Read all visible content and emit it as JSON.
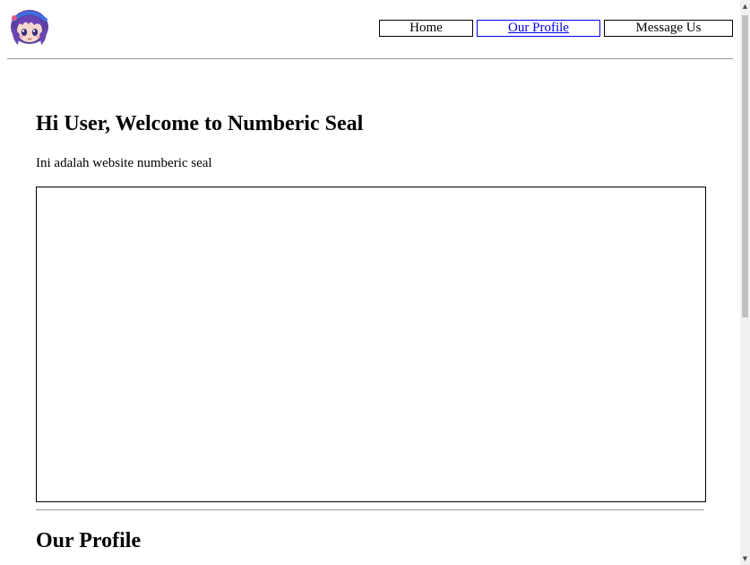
{
  "header": {
    "logo_icon": "anime-girl-avatar-icon",
    "nav": [
      {
        "label": "Home",
        "active": false
      },
      {
        "label": "Our Profile",
        "active": true
      },
      {
        "label": "Message Us",
        "active": false
      }
    ]
  },
  "main": {
    "title": "Hi User, Welcome to Numberic Seal",
    "subtitle": "Ini adalah website numberic seal",
    "section_title": "Our Profile"
  },
  "colors": {
    "link": "#0000ee",
    "divider": "#999999",
    "hair": "#5b3fa0"
  }
}
